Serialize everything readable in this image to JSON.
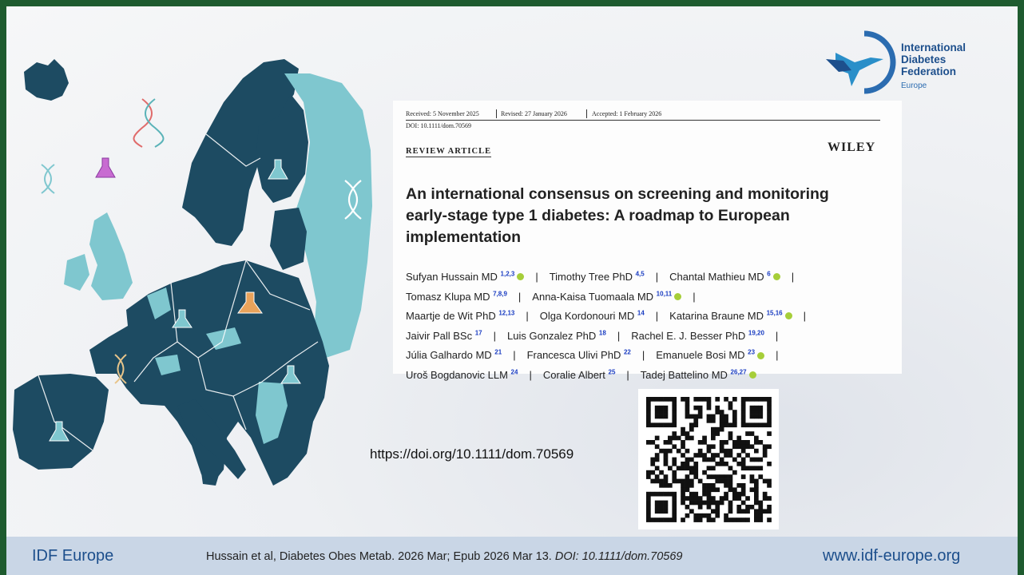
{
  "logo": {
    "line1": "International",
    "line2": "Diabetes",
    "line3": "Federation",
    "region": "Europe"
  },
  "paper": {
    "received": "Received: 5 November 2025",
    "revised": "Revised: 27 January 2026",
    "accepted": "Accepted: 1 February 2026",
    "doi": "DOI: 10.1111/dom.70569",
    "section": "REVIEW ARTICLE",
    "publisher": "WILEY",
    "title": "An international consensus on screening and monitoring early-stage type 1 diabetes: A roadmap to European implementation",
    "authors": [
      {
        "name": "Sufyan Hussain MD",
        "sup": "1,2,3",
        "orcid": true
      },
      {
        "name": "Timothy Tree PhD",
        "sup": "4,5",
        "orcid": false
      },
      {
        "name": "Chantal Mathieu MD",
        "sup": "6",
        "orcid": true
      },
      {
        "name": "Tomasz Klupa MD",
        "sup": "7,8,9",
        "orcid": false
      },
      {
        "name": "Anna-Kaisa Tuomaala MD",
        "sup": "10,11",
        "orcid": true
      },
      {
        "name": "Maartje de Wit PhD",
        "sup": "12,13",
        "orcid": false
      },
      {
        "name": "Olga Kordonouri MD",
        "sup": "14",
        "orcid": false
      },
      {
        "name": "Katarina Braune MD",
        "sup": "15,16",
        "orcid": true
      },
      {
        "name": "Jaivir Pall BSc",
        "sup": "17",
        "orcid": false
      },
      {
        "name": "Luis Gonzalez PhD",
        "sup": "18",
        "orcid": false
      },
      {
        "name": "Rachel E. J. Besser PhD",
        "sup": "19,20",
        "orcid": false
      },
      {
        "name": "Júlia Galhardo MD",
        "sup": "21",
        "orcid": false
      },
      {
        "name": "Francesca Ulivi PhD",
        "sup": "22",
        "orcid": false
      },
      {
        "name": "Emanuele Bosi MD",
        "sup": "23",
        "orcid": true
      },
      {
        "name": "Uroš Bogdanovic LLM",
        "sup": "24",
        "orcid": false
      },
      {
        "name": "Coralie Albert",
        "sup": "25",
        "orcid": false
      },
      {
        "name": "Tadej Battelino MD",
        "sup": "26,27",
        "orcid": true
      }
    ],
    "author_lines": [
      [
        0,
        1,
        2
      ],
      [
        3,
        4
      ],
      [
        5,
        6,
        7
      ],
      [
        8,
        9,
        10
      ],
      [
        11,
        12,
        13
      ],
      [
        14,
        15,
        16
      ]
    ],
    "author_lines_trailing_bar": [
      true,
      true,
      true,
      true,
      true,
      false
    ]
  },
  "doi_url": "https://doi.org/10.1111/dom.70569",
  "qr_label": "qr-code",
  "footer": {
    "left": "IDF Europe",
    "citation": "Hussain et al, Diabetes Obes Metab. 2026 Mar; Epub 2026 Mar 13.",
    "citation_doi": "DOI: 10.1111/dom.70569",
    "right": "www.idf-europe.org"
  },
  "colors": {
    "map_dark": "#1d4b62",
    "map_light": "#7fc7cf",
    "accent": "#1d4f8c",
    "orcid": "#a6ce39",
    "footer_bg": "#c9d6e6"
  },
  "icons": [
    "dna-icon",
    "flask-icon",
    "idf-hummingbird-logo"
  ]
}
